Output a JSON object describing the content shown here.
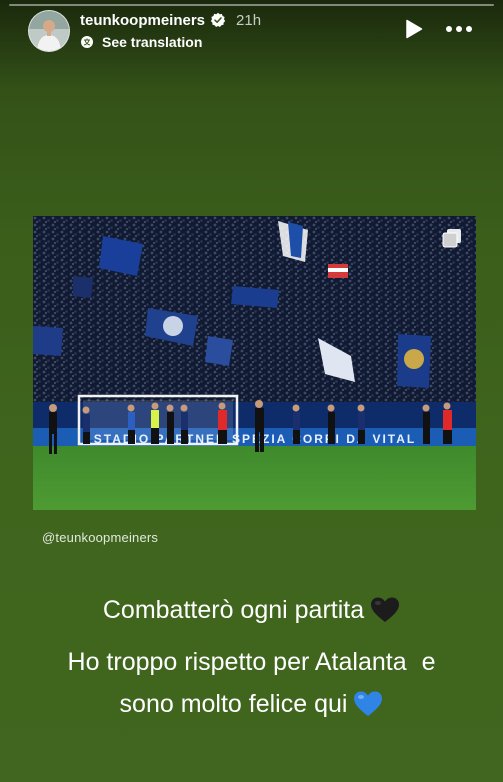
{
  "header": {
    "username": "teunkoopmeiners",
    "time": "21h",
    "see_translation": "See translation"
  },
  "photo": {
    "mention": "@teunkoopmeiners",
    "banner_text": "STADIO  PARTNER  SPEZIA  CORRI  DA  VITAL"
  },
  "caption": {
    "line1": "Combatterò ogni partita",
    "line2": "Ho troppo rispetto per Atalanta",
    "line2_suffix": "e",
    "line3": "sono molto felice qui"
  },
  "emoji": {
    "line1": "black-heart",
    "line3": "blue-heart"
  }
}
